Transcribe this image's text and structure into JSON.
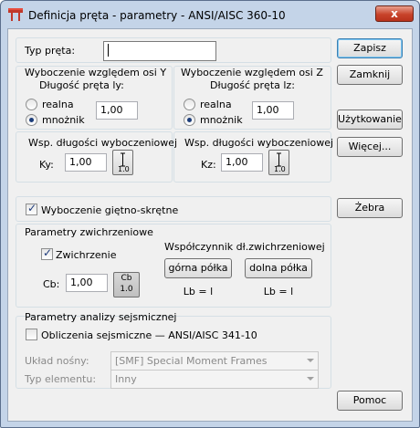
{
  "window": {
    "title": "Definicja pręta - parametry - ANSI/AISC 360-10",
    "close_label": "x"
  },
  "typ_preta": {
    "label": "Typ pręta:",
    "value": ""
  },
  "buckling_y": {
    "title": "Wyboczenie względem osi Y",
    "length_label": "Długość pręta ly:",
    "option_real": "realna",
    "option_mult": "mnożnik",
    "selected": "mnożnik",
    "value": "1,00",
    "coef_title": "Wsp. długości wyboczeniowej",
    "coef_label": "Ky:",
    "coef_value": "1,00",
    "coef_button": "1.0"
  },
  "buckling_z": {
    "title": "Wyboczenie względem osi Z",
    "length_label": "Długość pręta lz:",
    "option_real": "realna",
    "option_mult": "mnożnik",
    "selected": "mnożnik",
    "value": "1,00",
    "coef_title": "Wsp. długości wyboczeniowej",
    "coef_label": "Kz:",
    "coef_value": "1,00",
    "coef_button": "1.0"
  },
  "torsional": {
    "label": "Wyboczenie giętno-skrętne",
    "checked": true
  },
  "lateral": {
    "title": "Parametry zwichrzeniowe",
    "checkbox_label": "Zwichrzenie",
    "checked": true,
    "cb_label": "Cb:",
    "cb_value": "1,00",
    "cb_button_top": "Cb",
    "cb_button_bottom": "1.0",
    "coef_title": "Współczynnik dł.zwichrzeniowej",
    "upper_flange": "górna półka",
    "lower_flange": "dolna półka",
    "lb_upper": "Lb = l",
    "lb_lower": "Lb = l"
  },
  "seismic": {
    "title": "Parametry analizy sejsmicznej",
    "checkbox_label": "Obliczenia sejsmiczne — ANSI/AISC 341-10",
    "checked": false,
    "system_label": "Układ nośny:",
    "system_value": "[SMF] Special Moment Frames",
    "element_label": "Typ elementu:",
    "element_value": "Inny"
  },
  "buttons": {
    "save": "Zapisz",
    "close": "Zamknij",
    "user": "Użytkowanie",
    "more": "Więcej...",
    "ribs": "Żebra",
    "help": "Pomoc"
  }
}
